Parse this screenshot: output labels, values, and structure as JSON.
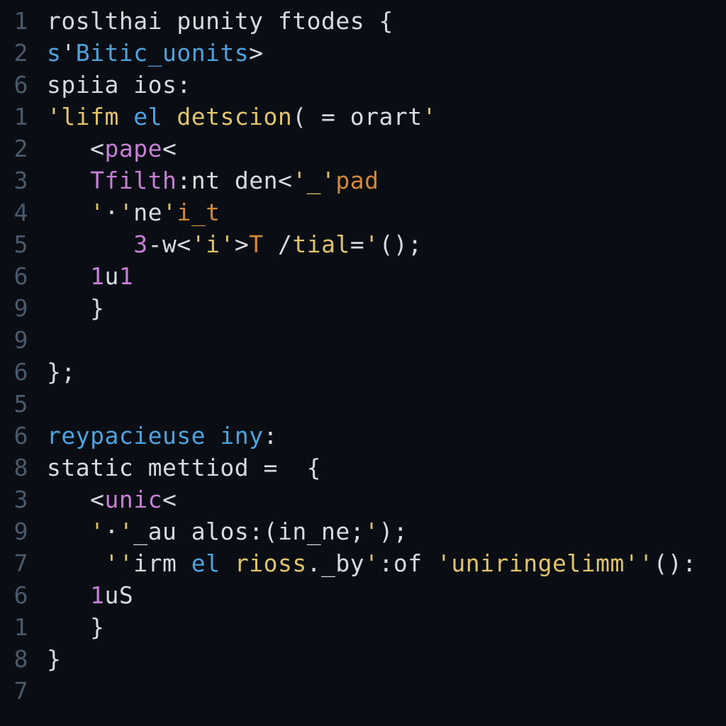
{
  "colors": {
    "background": "#0a0e14",
    "gutter": "#4b5a6b",
    "plain": "#d7dae0",
    "keyword": "#4ea3e0",
    "string": "#e0c36b",
    "tag": "#c77fd6",
    "type": "#d1883b",
    "number": "#c77fd6"
  },
  "gutter": [
    "1",
    "2",
    "6",
    "1",
    "2",
    "3",
    "4",
    "5",
    "6",
    "9",
    "9",
    "6",
    "5",
    "6",
    "8",
    "3",
    "9",
    "7",
    "6",
    "1",
    "8",
    "7"
  ],
  "lines": [
    {
      "indent": 0,
      "tokens": [
        {
          "cls": "tk-ident",
          "t": "roslthai"
        },
        {
          "cls": "tk-plain",
          "t": " "
        },
        {
          "cls": "tk-ident",
          "t": "punity"
        },
        {
          "cls": "tk-plain",
          "t": " "
        },
        {
          "cls": "tk-ident",
          "t": "ftodes"
        },
        {
          "cls": "tk-plain",
          "t": " "
        },
        {
          "cls": "tk-punct",
          "t": "{"
        }
      ]
    },
    {
      "indent": 0,
      "tokens": [
        {
          "cls": "tk-keyword",
          "t": "s"
        },
        {
          "cls": "tk-punct",
          "t": "'"
        },
        {
          "cls": "tk-keyword",
          "t": "Bitic_uonits"
        },
        {
          "cls": "tk-punct",
          "t": ">"
        }
      ]
    },
    {
      "indent": 0,
      "tokens": [
        {
          "cls": "tk-ident",
          "t": "spiia"
        },
        {
          "cls": "tk-plain",
          "t": " "
        },
        {
          "cls": "tk-ident",
          "t": "ios"
        },
        {
          "cls": "tk-punct",
          "t": ":"
        }
      ]
    },
    {
      "indent": 0,
      "tokens": [
        {
          "cls": "tk-string",
          "t": "'lifm"
        },
        {
          "cls": "tk-plain",
          "t": " "
        },
        {
          "cls": "tk-keyword",
          "t": "el"
        },
        {
          "cls": "tk-plain",
          "t": " "
        },
        {
          "cls": "tk-func",
          "t": "detscion"
        },
        {
          "cls": "tk-punct",
          "t": "("
        },
        {
          "cls": "tk-plain",
          "t": " "
        },
        {
          "cls": "tk-op",
          "t": "="
        },
        {
          "cls": "tk-plain",
          "t": " "
        },
        {
          "cls": "tk-ident",
          "t": "orart"
        },
        {
          "cls": "tk-string",
          "t": "'"
        }
      ]
    },
    {
      "indent": 1,
      "tokens": [
        {
          "cls": "tk-punct",
          "t": "<"
        },
        {
          "cls": "tk-tag",
          "t": "pape"
        },
        {
          "cls": "tk-punct",
          "t": "<"
        }
      ]
    },
    {
      "indent": 1,
      "tokens": [
        {
          "cls": "tk-attr",
          "t": "Tfilth"
        },
        {
          "cls": "tk-punct",
          "t": ":"
        },
        {
          "cls": "tk-ident",
          "t": "nt"
        },
        {
          "cls": "tk-plain",
          "t": " "
        },
        {
          "cls": "tk-ident",
          "t": "den"
        },
        {
          "cls": "tk-punct",
          "t": "<"
        },
        {
          "cls": "tk-string",
          "t": "'_'"
        },
        {
          "cls": "tk-type",
          "t": "pad"
        }
      ]
    },
    {
      "indent": 1,
      "tokens": [
        {
          "cls": "tk-string",
          "t": "'"
        },
        {
          "cls": "tk-punct",
          "t": "·"
        },
        {
          "cls": "tk-string",
          "t": "'"
        },
        {
          "cls": "tk-ident",
          "t": "ne"
        },
        {
          "cls": "tk-string",
          "t": "'"
        },
        {
          "cls": "tk-type",
          "t": "i_t"
        }
      ]
    },
    {
      "indent": 2,
      "tokens": [
        {
          "cls": "tk-num",
          "t": "3"
        },
        {
          "cls": "tk-punct",
          "t": "-"
        },
        {
          "cls": "tk-ident",
          "t": "w"
        },
        {
          "cls": "tk-punct",
          "t": "<"
        },
        {
          "cls": "tk-string",
          "t": "'i'"
        },
        {
          "cls": "tk-punct",
          "t": ">"
        },
        {
          "cls": "tk-type",
          "t": "T"
        },
        {
          "cls": "tk-plain",
          "t": " "
        },
        {
          "cls": "tk-punct",
          "t": "/"
        },
        {
          "cls": "tk-func",
          "t": "tial"
        },
        {
          "cls": "tk-op",
          "t": "="
        },
        {
          "cls": "tk-string",
          "t": "'"
        },
        {
          "cls": "tk-punct",
          "t": "();"
        }
      ]
    },
    {
      "indent": 1,
      "tokens": [
        {
          "cls": "tk-num",
          "t": "1"
        },
        {
          "cls": "tk-ident",
          "t": "u"
        },
        {
          "cls": "tk-num",
          "t": "1"
        }
      ]
    },
    {
      "indent": 1,
      "tokens": [
        {
          "cls": "tk-punct",
          "t": "}"
        }
      ]
    },
    {
      "indent": 0,
      "tokens": []
    },
    {
      "indent": 0,
      "tokens": [
        {
          "cls": "tk-punct",
          "t": "};"
        }
      ]
    },
    {
      "indent": 0,
      "tokens": []
    },
    {
      "indent": 0,
      "tokens": [
        {
          "cls": "tk-keyword",
          "t": "reypacieuse"
        },
        {
          "cls": "tk-plain",
          "t": " "
        },
        {
          "cls": "tk-keyword",
          "t": "iny"
        },
        {
          "cls": "tk-punct",
          "t": ":"
        }
      ]
    },
    {
      "indent": 0,
      "tokens": [
        {
          "cls": "tk-ident",
          "t": "static"
        },
        {
          "cls": "tk-plain",
          "t": " "
        },
        {
          "cls": "tk-ident",
          "t": "mettiod"
        },
        {
          "cls": "tk-plain",
          "t": " "
        },
        {
          "cls": "tk-op",
          "t": "="
        },
        {
          "cls": "tk-plain",
          "t": "  "
        },
        {
          "cls": "tk-punct",
          "t": "{"
        }
      ]
    },
    {
      "indent": 1,
      "tokens": [
        {
          "cls": "tk-punct",
          "t": "<"
        },
        {
          "cls": "tk-tag",
          "t": "unic"
        },
        {
          "cls": "tk-punct",
          "t": "<"
        }
      ]
    },
    {
      "indent": 1,
      "tokens": [
        {
          "cls": "tk-string",
          "t": "'"
        },
        {
          "cls": "tk-punct",
          "t": "·"
        },
        {
          "cls": "tk-string",
          "t": "'"
        },
        {
          "cls": "tk-ident",
          "t": "_au"
        },
        {
          "cls": "tk-plain",
          "t": " "
        },
        {
          "cls": "tk-ident",
          "t": "alos"
        },
        {
          "cls": "tk-punct",
          "t": ":("
        },
        {
          "cls": "tk-ident",
          "t": "in_ne"
        },
        {
          "cls": "tk-punct",
          "t": ";"
        },
        {
          "cls": "tk-string",
          "t": "'"
        },
        {
          "cls": "tk-punct",
          "t": ");"
        }
      ]
    },
    {
      "indent": 1,
      "tokens": [
        {
          "cls": "tk-plain",
          "t": " "
        },
        {
          "cls": "tk-string",
          "t": "''"
        },
        {
          "cls": "tk-ident",
          "t": "irm"
        },
        {
          "cls": "tk-plain",
          "t": " "
        },
        {
          "cls": "tk-keyword",
          "t": "el"
        },
        {
          "cls": "tk-plain",
          "t": " "
        },
        {
          "cls": "tk-func",
          "t": "rioss"
        },
        {
          "cls": "tk-punct",
          "t": "."
        },
        {
          "cls": "tk-ident",
          "t": "_by"
        },
        {
          "cls": "tk-string",
          "t": "'"
        },
        {
          "cls": "tk-punct",
          "t": ":"
        },
        {
          "cls": "tk-ident",
          "t": "of"
        },
        {
          "cls": "tk-plain",
          "t": " "
        },
        {
          "cls": "tk-string",
          "t": "'uniringelimm'"
        },
        {
          "cls": "tk-string",
          "t": "'"
        },
        {
          "cls": "tk-punct",
          "t": "()"
        },
        {
          "cls": "tk-punct",
          "t": ":"
        }
      ]
    },
    {
      "indent": 1,
      "tokens": [
        {
          "cls": "tk-num",
          "t": "1"
        },
        {
          "cls": "tk-ident",
          "t": "uS"
        }
      ]
    },
    {
      "indent": 1,
      "tokens": [
        {
          "cls": "tk-punct",
          "t": "}"
        }
      ]
    },
    {
      "indent": 0,
      "tokens": [
        {
          "cls": "tk-punct",
          "t": "}"
        }
      ]
    },
    {
      "indent": 0,
      "tokens": []
    }
  ],
  "indentUnit": "   "
}
